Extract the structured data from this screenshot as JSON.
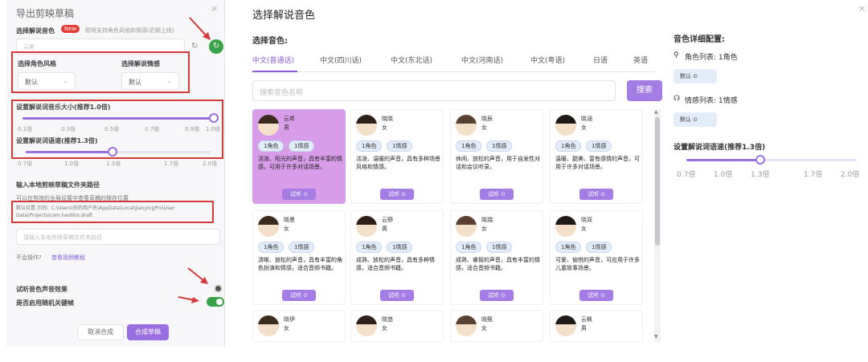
{
  "left_panel": {
    "title": "导出剪映草稿",
    "close": "×",
    "voice_label": "选择解说音色",
    "new_badge": "New",
    "voice_hint": "即将支持角色风格和情感(近期上线)",
    "voice_value": "云希",
    "refresh_icon": "↻",
    "confirm_icon": "↻",
    "style_label": "选择角色风格",
    "emotion_label": "选择解说情感",
    "style_value": "默认",
    "emotion_value": "默认",
    "volume_label": "设置解说词音乐大小(推荐1.0倍)",
    "volume_ticks": [
      "0.1倍",
      "0.3倍",
      "0.5倍",
      "0.7倍",
      "0.9倍",
      "1.0倍"
    ],
    "volume_value": 1.0,
    "speed_label": "设置解说词语速(推荐1.3倍)",
    "speed_ticks": [
      "0.7倍",
      "1.0倍",
      "1.3倍",
      "1.7倍",
      "2.0倍"
    ],
    "speed_value": 1.3,
    "path_label": "输入本地剪映草稿文件夹路径",
    "path_hint": "可以在剪映的全局设置中查看草稿的保存位置",
    "path_default_line1": "默认位置  示例：C:\\Users\\你的用户名\\AppData\\Local\\JianyingPro\\User",
    "path_default_line2": "Data\\Projects\\com.lveditor.draft",
    "path_placeholder": "请输入本地剪映草稿文件夹路径",
    "help_q": "不会操作?",
    "help_link": "查看视频教程",
    "preview_label": "试听音色声音效果",
    "random_label": "是否启用随机关键帧",
    "cancel_btn": "取消合成",
    "ok_btn": "合成草稿"
  },
  "right_panel": {
    "title": "选择解说音色",
    "close": "×",
    "choose_voice_label": "选择音色:",
    "tabs": [
      "中文(普通话)",
      "中文(四川话)",
      "中文(东北话)",
      "中文(河南话)",
      "中文(粤语)",
      "日语",
      "英语"
    ],
    "search_placeholder": "搜索音色名称",
    "search_btn": "搜索",
    "role_tag": "1角色",
    "emotion_tag": "1情感",
    "listen_btn": "试听 ⊙",
    "cards": [
      {
        "name": "云希",
        "gender": "男",
        "desc": "活泼、阳光的声音，具有丰富的情感，可用于许多对话场景。",
        "selected": true
      },
      {
        "name": "晓晓",
        "gender": "女",
        "desc": "活泼、温暖的声音，具有多种场景风格和情感。",
        "selected": false
      },
      {
        "name": "晓辰",
        "gender": "女",
        "desc": "休闲、放松的声音，用于自发性对话和会议听录。",
        "selected": false
      },
      {
        "name": "晓涵",
        "gender": "女",
        "desc": "温暖、甜美、富有感情的声音，可用于许多对话场景。",
        "selected": false
      },
      {
        "name": "晓墨",
        "gender": "女",
        "desc": "清晰、放松的声音，具有丰富的角色扮演和情感，适合音频书籍。",
        "selected": false
      },
      {
        "name": "云野",
        "gender": "男",
        "desc": "成熟、放松的声音，具有多种情感，适合音频书籍。",
        "selected": false
      },
      {
        "name": "晓瑞",
        "gender": "女",
        "desc": "成熟、睿智的声音，具有丰富的情感，适合音频书籍。",
        "selected": false
      },
      {
        "name": "晓双",
        "gender": "女",
        "desc": "可爱、愉悦的声音，可应用于许多儿童故事场景。",
        "selected": false
      },
      {
        "name": "晓伊",
        "gender": "女",
        "desc": "",
        "selected": false
      },
      {
        "name": "晓悠",
        "gender": "女",
        "desc": "",
        "selected": false
      },
      {
        "name": "晓甄",
        "gender": "女",
        "desc": "",
        "selected": false
      },
      {
        "name": "云枫",
        "gender": "男",
        "desc": "",
        "selected": false
      }
    ],
    "detail_title": "音色详细配置:",
    "role_list_label": "角色列表: 1角色",
    "role_default": "默认 ⊙",
    "emotion_list_label": "情感列表: 1情感",
    "emotion_default": "默认 ⊙",
    "speed_label": "设置解说词语速(推荐1.3倍)",
    "speed_ticks": [
      "0.7倍",
      "1.0倍",
      "1.3倍",
      "1.7倍",
      "2.0倍"
    ],
    "speed_value": 1.3
  },
  "colors": {
    "accent": "#9b6fe0",
    "selected_card": "#d79de9",
    "highlight_red": "#d23a3a",
    "toggle_green": "#3aa34a"
  }
}
